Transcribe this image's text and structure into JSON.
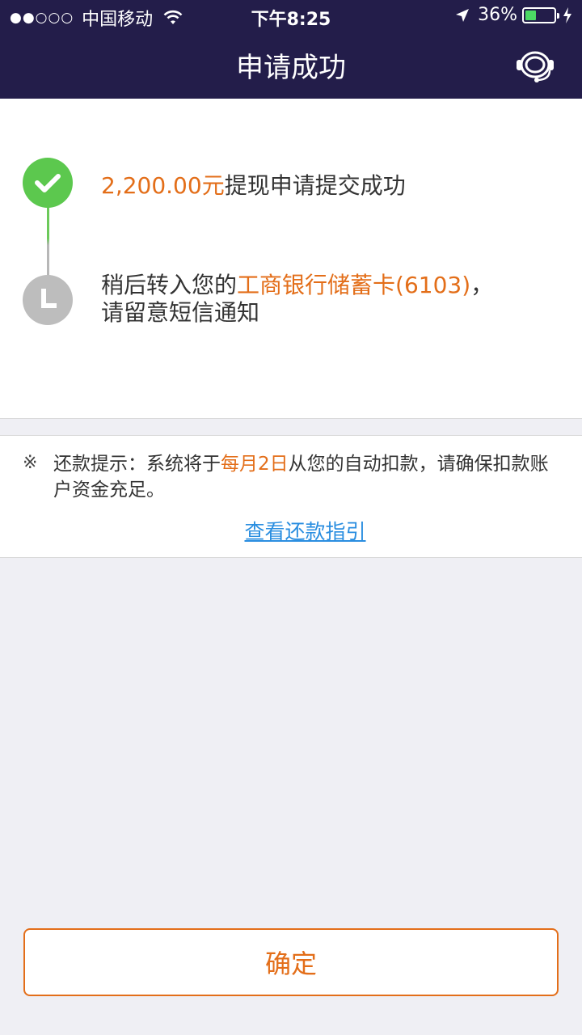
{
  "status_bar": {
    "signal": "●●○○○",
    "carrier": "中国移动",
    "time": "下午8:25",
    "battery": "36%"
  },
  "header": {
    "title": "申请成功",
    "support_icon": "headset-icon"
  },
  "steps": [
    {
      "icon": "check-icon",
      "amount": "2,200.00元",
      "text": "提现申请提交成功",
      "color": "#5cc84e"
    },
    {
      "icon": "clock-icon",
      "text_before": "稍后转入您的",
      "bank": "工商银行储蓄卡(6103)",
      "text_after": "，",
      "line2": "请留意短信通知",
      "color": "#bdbdbd"
    }
  ],
  "notice": {
    "mark": "※",
    "text_before": "还款提示：系统将于",
    "highlight": "每月2日",
    "text_after": "从您的自动扣款，请确保扣款账户资金充足。",
    "link": "查看还款指引"
  },
  "confirm_button": "确定",
  "colors": {
    "header_bg": "#231d4a",
    "accent_orange": "#e36e19",
    "link_blue": "#2a8ee0",
    "success_green": "#5cc84e"
  }
}
